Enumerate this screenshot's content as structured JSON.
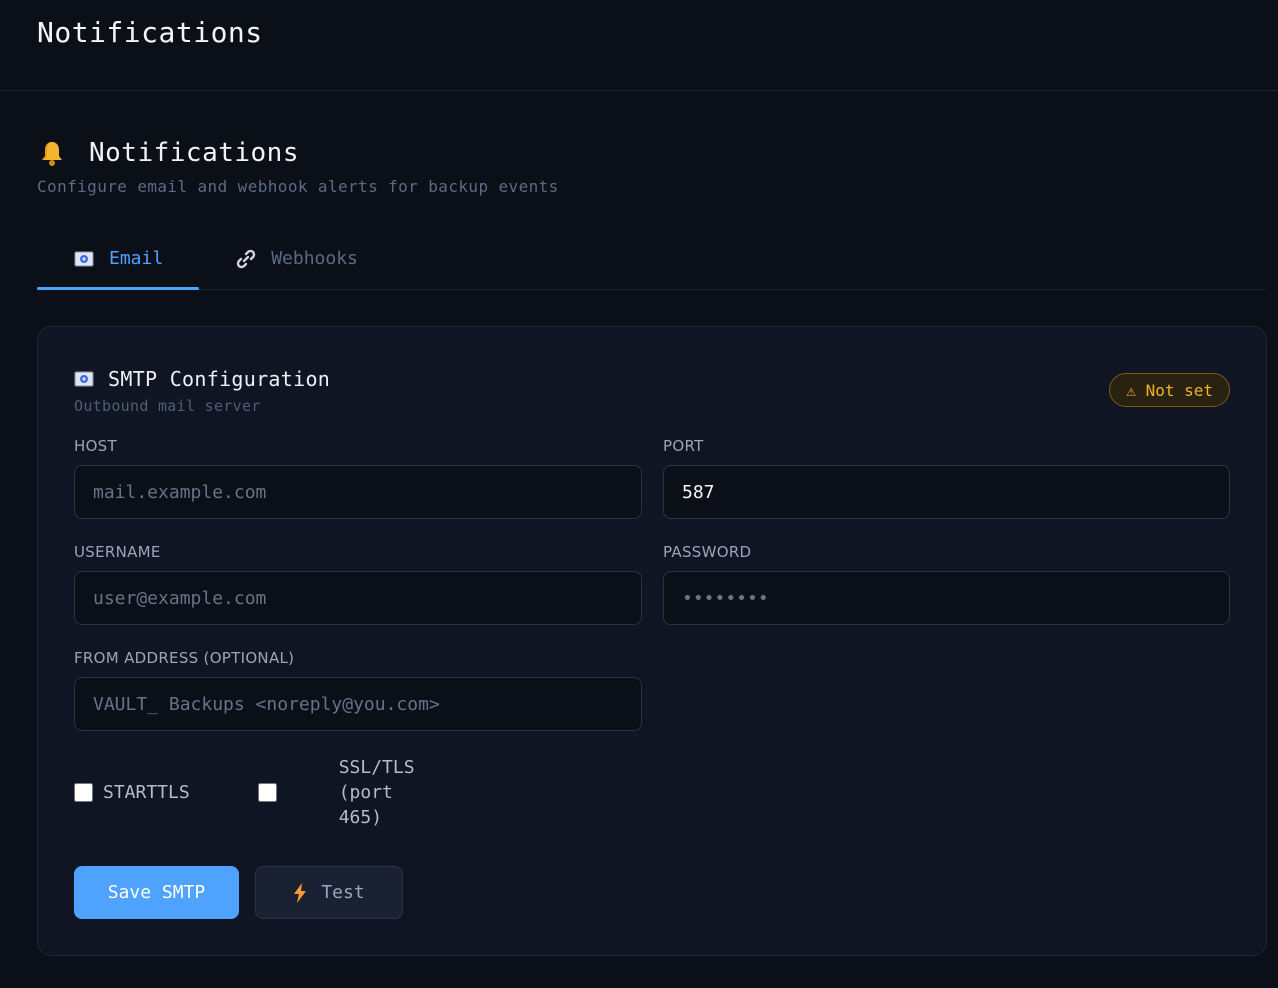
{
  "topbar": {
    "title": "Notifications"
  },
  "section": {
    "title": "Notifications",
    "subtitle": "Configure email and webhook alerts for backup events"
  },
  "tabs": [
    {
      "label": "Email",
      "icon": "envelope-icon",
      "active": true
    },
    {
      "label": "Webhooks",
      "icon": "link-icon",
      "active": false
    }
  ],
  "smtp": {
    "title": "SMTP Configuration",
    "subtitle": "Outbound mail server",
    "status_badge": "⚠ Not set",
    "fields": {
      "host": {
        "label": "HOST",
        "value": "",
        "placeholder": "mail.example.com"
      },
      "port": {
        "label": "PORT",
        "value": "587",
        "placeholder": ""
      },
      "username": {
        "label": "USERNAME",
        "value": "",
        "placeholder": "user@example.com"
      },
      "password": {
        "label": "PASSWORD",
        "value": "",
        "placeholder": "••••••••"
      },
      "from": {
        "label": "FROM ADDRESS (OPTIONAL)",
        "value": "",
        "placeholder": "VAULT_ Backups <noreply@you.com>"
      }
    },
    "checkboxes": {
      "starttls": {
        "label": "STARTTLS",
        "checked": false
      },
      "ssl": {
        "label": "SSL/TLS (port 465)",
        "checked": false
      }
    },
    "buttons": {
      "save": "Save SMTP",
      "test": "Test"
    }
  },
  "colors": {
    "accent": "#4fa3ff",
    "warning": "#f0b429",
    "background": "#0b0f18",
    "card": "#0f1522"
  }
}
